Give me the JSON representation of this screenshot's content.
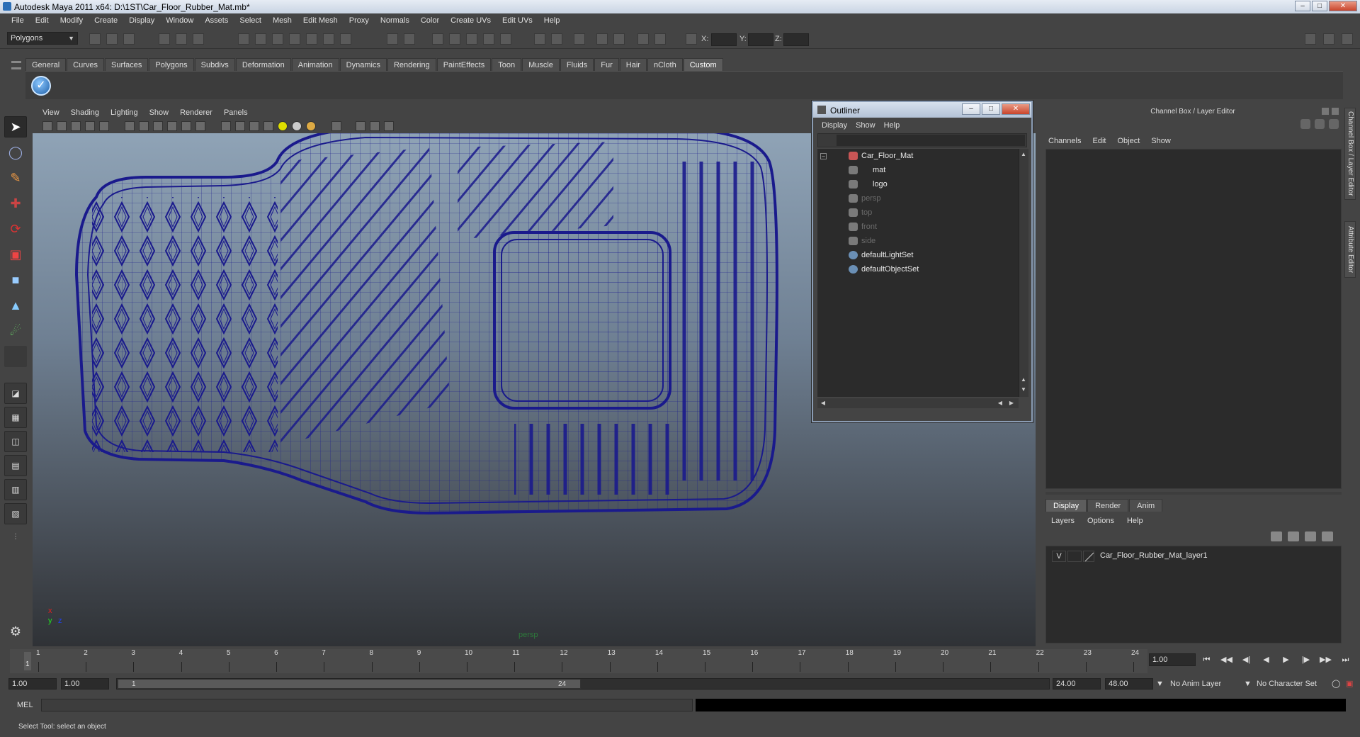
{
  "window": {
    "title": "Autodesk Maya 2011 x64: D:\\1ST\\Car_Floor_Rubber_Mat.mb*"
  },
  "menubar": [
    "File",
    "Edit",
    "Modify",
    "Create",
    "Display",
    "Window",
    "Assets",
    "Select",
    "Mesh",
    "Edit Mesh",
    "Proxy",
    "Normals",
    "Color",
    "Create UVs",
    "Edit UVs",
    "Help"
  ],
  "statusline": {
    "mode": "Polygons",
    "x_label": "X:",
    "y_label": "Y:",
    "z_label": "Z:"
  },
  "shelf": {
    "tabs": [
      "General",
      "Curves",
      "Surfaces",
      "Polygons",
      "Subdivs",
      "Deformation",
      "Animation",
      "Dynamics",
      "Rendering",
      "PaintEffects",
      "Toon",
      "Muscle",
      "Fluids",
      "Fur",
      "Hair",
      "nCloth",
      "Custom"
    ],
    "active_tab": "Custom"
  },
  "viewport": {
    "menu": [
      "View",
      "Shading",
      "Lighting",
      "Show",
      "Renderer",
      "Panels"
    ],
    "camera": "persp",
    "axis": {
      "x": "x",
      "y": "y",
      "z": "z"
    },
    "wire_color": "#1a1a8c"
  },
  "outliner": {
    "title": "Outliner",
    "menu": [
      "Display",
      "Show",
      "Help"
    ],
    "items": [
      {
        "label": "Car_Floor_Mat",
        "state": "bright",
        "indent": 0
      },
      {
        "label": "mat",
        "state": "bright",
        "indent": 1
      },
      {
        "label": "logo",
        "state": "bright",
        "indent": 1
      },
      {
        "label": "persp",
        "state": "dim",
        "indent": 0
      },
      {
        "label": "top",
        "state": "dim",
        "indent": 0
      },
      {
        "label": "front",
        "state": "dim",
        "indent": 0
      },
      {
        "label": "side",
        "state": "dim",
        "indent": 0
      },
      {
        "label": "defaultLightSet",
        "state": "bright",
        "indent": 0
      },
      {
        "label": "defaultObjectSet",
        "state": "bright",
        "indent": 0
      }
    ]
  },
  "channelbox": {
    "title": "Channel Box / Layer Editor",
    "menu": [
      "Channels",
      "Edit",
      "Object",
      "Show"
    ]
  },
  "layer_editor": {
    "tabs": [
      "Display",
      "Render",
      "Anim"
    ],
    "active_tab": "Display",
    "menu": [
      "Layers",
      "Options",
      "Help"
    ],
    "layers": [
      {
        "visible": "V",
        "name": "Car_Floor_Rubber_Mat_layer1"
      }
    ]
  },
  "side_tabs": [
    "Channel Box / Layer Editor",
    "Attribute Editor"
  ],
  "timeslider": {
    "ticks": [
      "1",
      "2",
      "3",
      "4",
      "5",
      "6",
      "7",
      "8",
      "9",
      "10",
      "11",
      "12",
      "13",
      "14",
      "15",
      "16",
      "17",
      "18",
      "19",
      "20",
      "21",
      "22",
      "23",
      "24"
    ],
    "current_frame": "1",
    "frame_field": "1.00"
  },
  "rangebar": {
    "start_time": "1.00",
    "playback_start": "1.00",
    "range_start": "1",
    "range_end": "24",
    "playback_end": "24.00",
    "end_time": "48.00",
    "anim_layer": "No Anim Layer",
    "character_set": "No Character Set"
  },
  "cmdline": {
    "label": "MEL"
  },
  "helpline": {
    "text": "Select Tool: select an object"
  }
}
